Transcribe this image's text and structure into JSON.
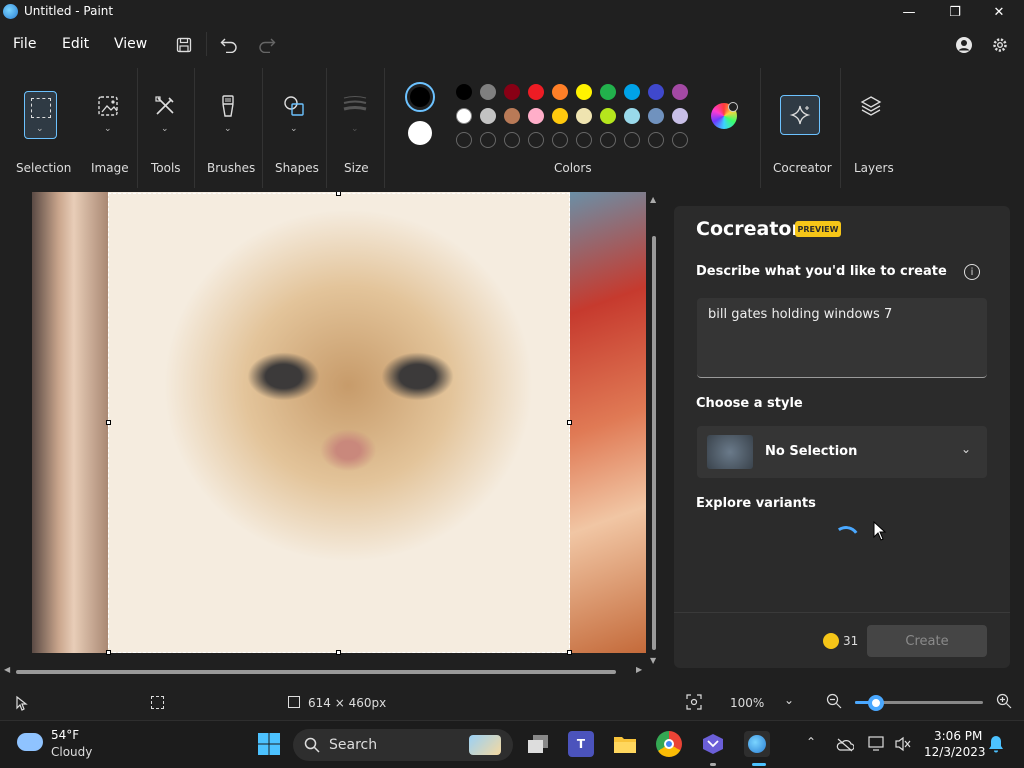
{
  "window": {
    "title": "Untitled - Paint",
    "minimize": "—",
    "maximize": "❐",
    "close": "✕"
  },
  "menu": {
    "file": "File",
    "edit": "Edit",
    "view": "View"
  },
  "ribbon": {
    "tools": [
      {
        "label": "Selection",
        "icon": "selection-icon"
      },
      {
        "label": "Image",
        "icon": "image-icon"
      },
      {
        "label": "Tools",
        "icon": "tools-icon"
      },
      {
        "label": "Brushes",
        "icon": "brush-icon"
      },
      {
        "label": "Shapes",
        "icon": "shapes-icon"
      },
      {
        "label": "Size",
        "icon": "size-icon"
      }
    ],
    "colors_label": "Colors",
    "cocreator_label": "Cocreator",
    "layers_label": "Layers",
    "primary_color": "#000000",
    "secondary_color": "#ffffff",
    "palette_row1": [
      "#000000",
      "#7f7f7f",
      "#880015",
      "#ed1c24",
      "#ff7f27",
      "#fff200",
      "#22b14c",
      "#00a2e8",
      "#3f48cc",
      "#a349a4"
    ],
    "palette_row2": [
      "#ffffff",
      "#c3c3c3",
      "#b97a57",
      "#ffaec9",
      "#ffc90e",
      "#efe4b0",
      "#b5e61d",
      "#99d9ea",
      "#7092be",
      "#c8bfe7"
    ],
    "palette_row3_empty": 10
  },
  "cocreator": {
    "title": "Cocreator",
    "badge": "PREVIEW",
    "describe_label": "Describe what you'd like to create",
    "prompt": "bill gates holding windows 7",
    "style_label": "Choose a style",
    "style_value": "No Selection",
    "variants_label": "Explore variants",
    "credits": "31",
    "create_label": "Create"
  },
  "status": {
    "dimensions": "614 × 460px",
    "zoom": "100%",
    "zoom_percent": 100
  },
  "taskbar": {
    "temperature": "54°F",
    "condition": "Cloudy",
    "search": "Search",
    "time": "3:06 PM",
    "date": "12/3/2023"
  },
  "colors": {
    "accent": "#4aa8ff",
    "badge": "#f5c518",
    "background": "#202020",
    "panel": "#2b2b2b"
  }
}
